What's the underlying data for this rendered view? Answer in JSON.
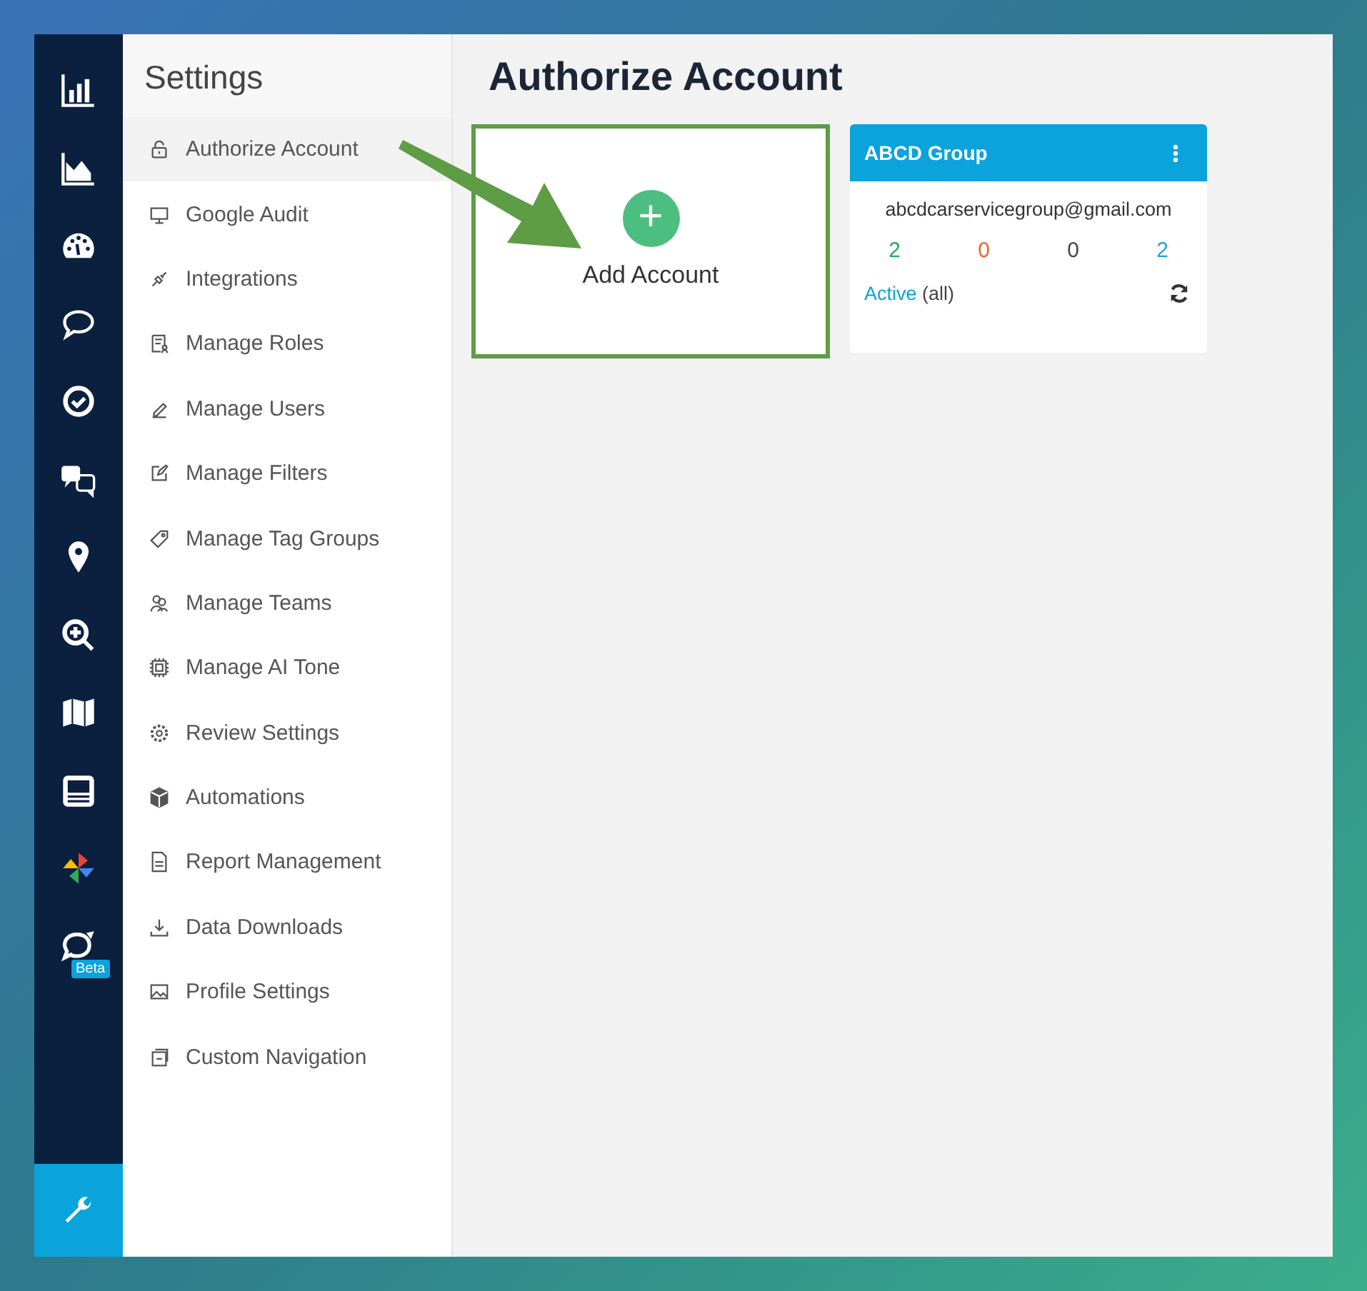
{
  "rail": {
    "items": [
      {
        "kind": "bar-chart",
        "selected": false
      },
      {
        "kind": "area-chart",
        "selected": false
      },
      {
        "kind": "gauge",
        "selected": false
      },
      {
        "kind": "speech-bubble",
        "selected": false
      },
      {
        "kind": "check-circle",
        "selected": false
      },
      {
        "kind": "qa",
        "selected": false
      },
      {
        "kind": "map-pin",
        "selected": false
      },
      {
        "kind": "zoom-in",
        "selected": false
      },
      {
        "kind": "map",
        "selected": false
      },
      {
        "kind": "panel",
        "selected": false
      },
      {
        "kind": "pinwheel",
        "selected": false
      },
      {
        "kind": "beta-bubble",
        "selected": false,
        "badge": "Beta"
      }
    ],
    "bottom": {
      "kind": "wrench",
      "selected": true
    }
  },
  "settings": {
    "title": "Settings",
    "items": [
      {
        "label": "Authorize Account",
        "kind": "lock",
        "selected": true
      },
      {
        "label": "Google Audit",
        "kind": "monitor",
        "selected": false
      },
      {
        "label": "Integrations",
        "kind": "plug",
        "selected": false
      },
      {
        "label": "Manage Roles",
        "kind": "doc-user",
        "selected": false
      },
      {
        "label": "Manage Users",
        "kind": "pen",
        "selected": false
      },
      {
        "label": "Manage Filters",
        "kind": "edit",
        "selected": false
      },
      {
        "label": "Manage Tag Groups",
        "kind": "tag",
        "selected": false
      },
      {
        "label": "Manage Teams",
        "kind": "users",
        "selected": false
      },
      {
        "label": "Manage AI Tone",
        "kind": "chip",
        "selected": false
      },
      {
        "label": "Review Settings",
        "kind": "gear",
        "selected": false
      },
      {
        "label": "Automations",
        "kind": "cube",
        "selected": false
      },
      {
        "label": "Report Management",
        "kind": "file",
        "selected": false
      },
      {
        "label": "Data Downloads",
        "kind": "download",
        "selected": false
      },
      {
        "label": "Profile Settings",
        "kind": "image",
        "selected": false
      },
      {
        "label": "Custom Navigation",
        "kind": "window",
        "selected": false
      }
    ]
  },
  "main": {
    "title": "Authorize Account",
    "add_tile": {
      "label": "Add Account",
      "symbol": "+"
    },
    "account": {
      "name": "ABCD Group",
      "email": "abcdcarservicegroup@gmail.com",
      "counts": [
        {
          "value": "2",
          "color": "#27ae60"
        },
        {
          "value": "0",
          "color": "#f0622d"
        },
        {
          "value": "0",
          "color": "#444444"
        },
        {
          "value": "2",
          "color": "#2a9fd8"
        }
      ],
      "status": "Active",
      "status_note": "(all)"
    }
  }
}
